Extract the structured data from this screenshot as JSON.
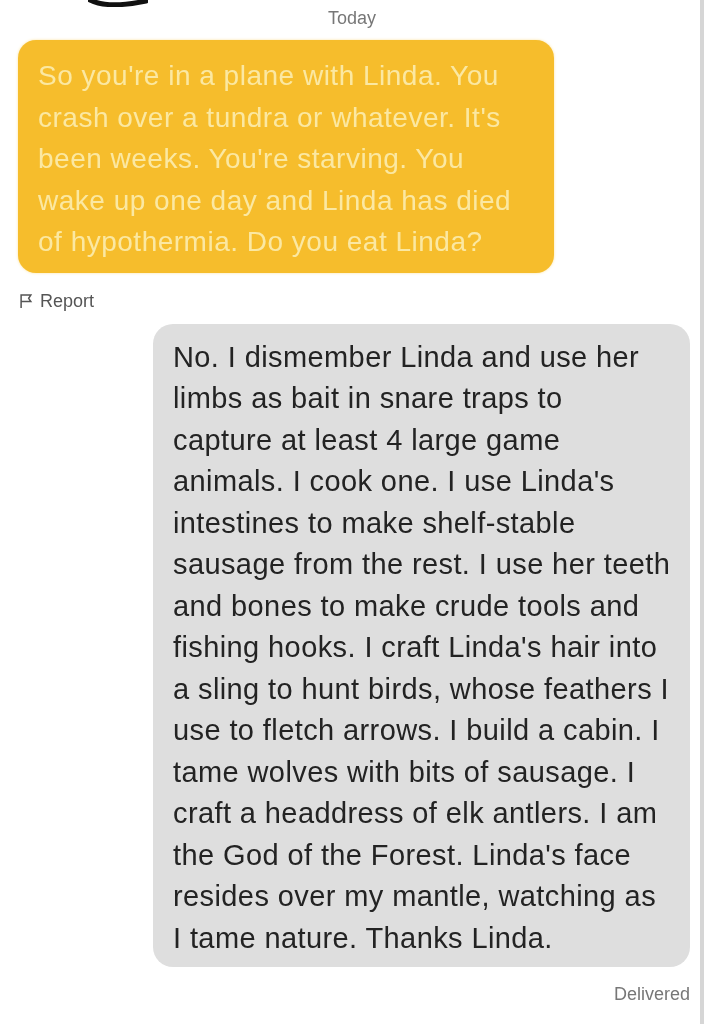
{
  "date_divider": "Today",
  "messages": [
    {
      "kind": "received",
      "text": "So you're in a plane with Linda. You\ncrash over a tundra or whatever. It's\nbeen weeks. You're starving. You\nwake up one day and Linda has died\nof hypothermia. Do you eat Linda?",
      "action": "Report"
    },
    {
      "kind": "sent",
      "text": "No. I dismember Linda and use her\nlimbs as bait in snare traps to\ncapture at least 4 large game\nanimals. I cook one. I use Linda's\nintestines to make shelf-stable\nsausage from the rest. I use her teeth\nand bones to make crude tools and\nfishing hooks. I craft Linda's hair into\na sling to hunt birds, whose feathers I\nuse to fletch arrows. I build a cabin. I\ntame wolves with bits of sausage. I\ncraft a headdress of elk antlers. I am\nthe God of the Forest. Linda's face\nresides over my mantle, watching as\nI tame nature. Thanks Linda.",
      "status": "Delivered"
    }
  ]
}
